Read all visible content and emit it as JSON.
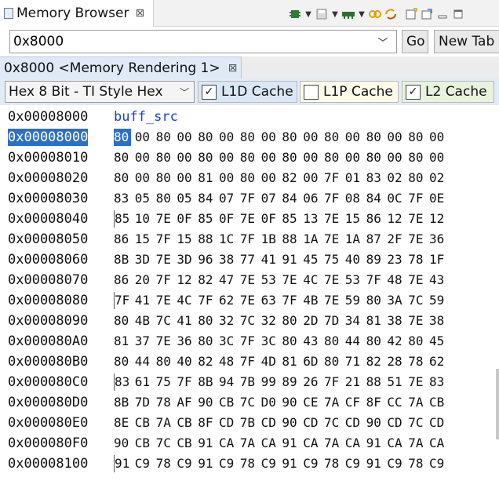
{
  "view": {
    "title": "Memory Browser",
    "close_glyph": "⊠"
  },
  "toolbar": {
    "icons": [
      "chip-run-icon",
      "dropdown-arrow-icon",
      "save-memory-icon",
      "dropdown-arrow-icon",
      "load-memory-icon",
      "dropdown-arrow-icon",
      "link-icon",
      "sync-icon",
      "new-view-icon",
      "pin-icon",
      "minimize-icon",
      "maximize-icon"
    ]
  },
  "address_bar": {
    "value": "0x8000",
    "go_label": "Go",
    "new_tab_label": "New Tab"
  },
  "rendering_tab": {
    "label": "0x8000 <Memory Rendering 1>",
    "close_glyph": "⊠"
  },
  "format": {
    "selected": "Hex 8 Bit - TI Style Hex"
  },
  "cache": {
    "l1d": {
      "label": "L1D Cache",
      "checked": true
    },
    "l1p": {
      "label": "L1P Cache",
      "checked": false
    },
    "l2": {
      "label": "L2 Cache",
      "checked": true
    }
  },
  "memory": {
    "symbol_row": {
      "address": "0x00008000",
      "label": "buff_src"
    },
    "rows": [
      {
        "address": "0x00008000",
        "bytes": [
          "80",
          "00",
          "80",
          "00",
          "80",
          "00",
          "80",
          "00",
          "80",
          "00",
          "80",
          "00",
          "80",
          "00",
          "80",
          "00"
        ]
      },
      {
        "address": "0x00008010",
        "bytes": [
          "80",
          "00",
          "80",
          "00",
          "80",
          "00",
          "80",
          "00",
          "80",
          "00",
          "80",
          "00",
          "80",
          "00",
          "80",
          "00"
        ]
      },
      {
        "address": "0x00008020",
        "bytes": [
          "80",
          "00",
          "80",
          "00",
          "81",
          "00",
          "80",
          "00",
          "82",
          "00",
          "7F",
          "01",
          "83",
          "02",
          "80",
          "02"
        ]
      },
      {
        "address": "0x00008030",
        "bytes": [
          "83",
          "05",
          "80",
          "05",
          "84",
          "07",
          "7F",
          "07",
          "84",
          "06",
          "7F",
          "08",
          "84",
          "0C",
          "7F",
          "0E"
        ]
      },
      {
        "address": "0x00008040",
        "bytes": [
          "85",
          "10",
          "7E",
          "0F",
          "85",
          "0F",
          "7E",
          "0F",
          "85",
          "13",
          "7E",
          "15",
          "86",
          "12",
          "7E",
          "12"
        ]
      },
      {
        "address": "0x00008050",
        "bytes": [
          "86",
          "15",
          "7F",
          "15",
          "88",
          "1C",
          "7F",
          "1B",
          "88",
          "1A",
          "7E",
          "1A",
          "87",
          "2F",
          "7E",
          "36"
        ]
      },
      {
        "address": "0x00008060",
        "bytes": [
          "8B",
          "3D",
          "7E",
          "3D",
          "96",
          "38",
          "77",
          "41",
          "91",
          "45",
          "75",
          "40",
          "89",
          "23",
          "78",
          "1F"
        ]
      },
      {
        "address": "0x00008070",
        "bytes": [
          "86",
          "20",
          "7F",
          "12",
          "82",
          "47",
          "7E",
          "53",
          "7E",
          "4C",
          "7E",
          "53",
          "7F",
          "48",
          "7E",
          "43"
        ]
      },
      {
        "address": "0x00008080",
        "bytes": [
          "7F",
          "41",
          "7E",
          "4C",
          "7F",
          "62",
          "7E",
          "63",
          "7F",
          "4B",
          "7E",
          "59",
          "80",
          "3A",
          "7C",
          "59"
        ]
      },
      {
        "address": "0x00008090",
        "bytes": [
          "80",
          "4B",
          "7C",
          "41",
          "80",
          "32",
          "7C",
          "32",
          "80",
          "2D",
          "7D",
          "34",
          "81",
          "38",
          "7E",
          "38"
        ]
      },
      {
        "address": "0x000080A0",
        "bytes": [
          "81",
          "37",
          "7E",
          "36",
          "80",
          "3C",
          "7F",
          "3C",
          "80",
          "43",
          "80",
          "44",
          "80",
          "42",
          "80",
          "45"
        ]
      },
      {
        "address": "0x000080B0",
        "bytes": [
          "80",
          "44",
          "80",
          "40",
          "82",
          "48",
          "7F",
          "4D",
          "81",
          "6D",
          "80",
          "71",
          "82",
          "28",
          "78",
          "62"
        ]
      },
      {
        "address": "0x000080C0",
        "bytes": [
          "83",
          "61",
          "75",
          "7F",
          "8B",
          "94",
          "7B",
          "99",
          "89",
          "26",
          "7F",
          "21",
          "88",
          "51",
          "7E",
          "83"
        ]
      },
      {
        "address": "0x000080D0",
        "bytes": [
          "8B",
          "7D",
          "78",
          "AF",
          "90",
          "CB",
          "7C",
          "D0",
          "90",
          "CE",
          "7A",
          "CF",
          "8F",
          "CC",
          "7A",
          "CB"
        ]
      },
      {
        "address": "0x000080E0",
        "bytes": [
          "8E",
          "CB",
          "7A",
          "CB",
          "8F",
          "CD",
          "7B",
          "CD",
          "90",
          "CD",
          "7C",
          "CD",
          "90",
          "CD",
          "7C",
          "CD"
        ]
      },
      {
        "address": "0x000080F0",
        "bytes": [
          "90",
          "CB",
          "7C",
          "CB",
          "91",
          "CA",
          "7A",
          "CA",
          "91",
          "CA",
          "7A",
          "CA",
          "91",
          "CA",
          "7A",
          "CA"
        ]
      },
      {
        "address": "0x00008100",
        "bytes": [
          "91",
          "C9",
          "78",
          "C9",
          "91",
          "C9",
          "78",
          "C9",
          "91",
          "C9",
          "78",
          "C9",
          "91",
          "C9",
          "78",
          "C9"
        ]
      }
    ],
    "selected_row": 0,
    "selected_byte": 0,
    "cache_line_rows": [
      4,
      8,
      12,
      16
    ]
  }
}
